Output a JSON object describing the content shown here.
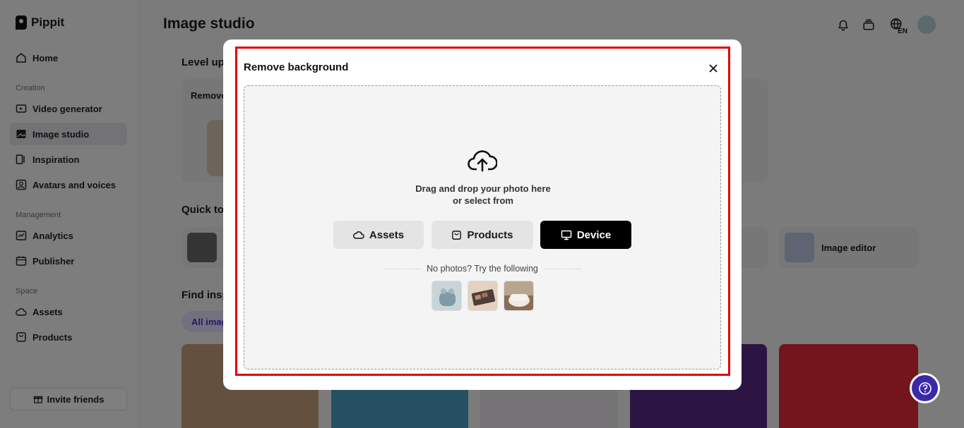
{
  "app": {
    "logo": "Pippit",
    "page_title": "Image studio"
  },
  "sidebar": {
    "home": "Home",
    "sections": {
      "creation": "Creation",
      "management": "Management",
      "space": "Space"
    },
    "items": [
      {
        "label": "Video generator"
      },
      {
        "label": "Image studio"
      },
      {
        "label": "Inspiration"
      },
      {
        "label": "Avatars and voices"
      },
      {
        "label": "Analytics"
      },
      {
        "label": "Publisher"
      },
      {
        "label": "Assets"
      },
      {
        "label": "Products"
      }
    ],
    "invite": "Invite friends"
  },
  "header": {
    "language": "EN"
  },
  "background": {
    "level_up": "Level up",
    "remove_card": "Remove",
    "quick_tools": "Quick to",
    "find_inspiration": "Find insp",
    "filter_all": "All imag",
    "image_editor": "Image editor"
  },
  "modal": {
    "title": "Remove background",
    "drop_line1": "Drag and drop your photo here",
    "drop_line2": "or select from",
    "buttons": {
      "assets": "Assets",
      "products": "Products",
      "device": "Device"
    },
    "try_text": "No photos? Try the following"
  },
  "colors": {
    "highlight": "#e00000",
    "accent": "#3b2aa8",
    "device_button": "#000000"
  }
}
